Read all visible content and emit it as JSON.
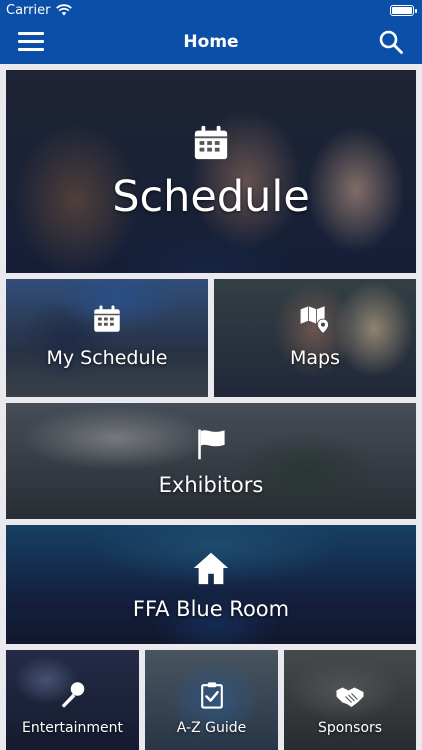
{
  "status_bar": {
    "carrier": "Carrier",
    "wifi_icon": "wifi-icon",
    "battery_icon": "battery-icon"
  },
  "nav_bar": {
    "title": "Home",
    "menu_icon": "hamburger-menu-icon",
    "search_icon": "search-icon",
    "background_color": "#0b4fa8"
  },
  "tiles": {
    "schedule": {
      "label": "Schedule",
      "icon": "calendar-icon"
    },
    "my_schedule": {
      "label": "My Schedule",
      "icon": "calendar-icon"
    },
    "maps": {
      "label": "Maps",
      "icon": "map-pin-icon"
    },
    "exhibitors": {
      "label": "Exhibitors",
      "icon": "flag-icon"
    },
    "blue_room": {
      "label": "FFA Blue Room",
      "icon": "home-icon"
    },
    "entertainment": {
      "label": "Entertainment",
      "icon": "microphone-icon"
    },
    "az_guide": {
      "label": "A-Z Guide",
      "icon": "clipboard-check-icon"
    },
    "sponsors": {
      "label": "Sponsors",
      "icon": "handshake-icon"
    }
  }
}
